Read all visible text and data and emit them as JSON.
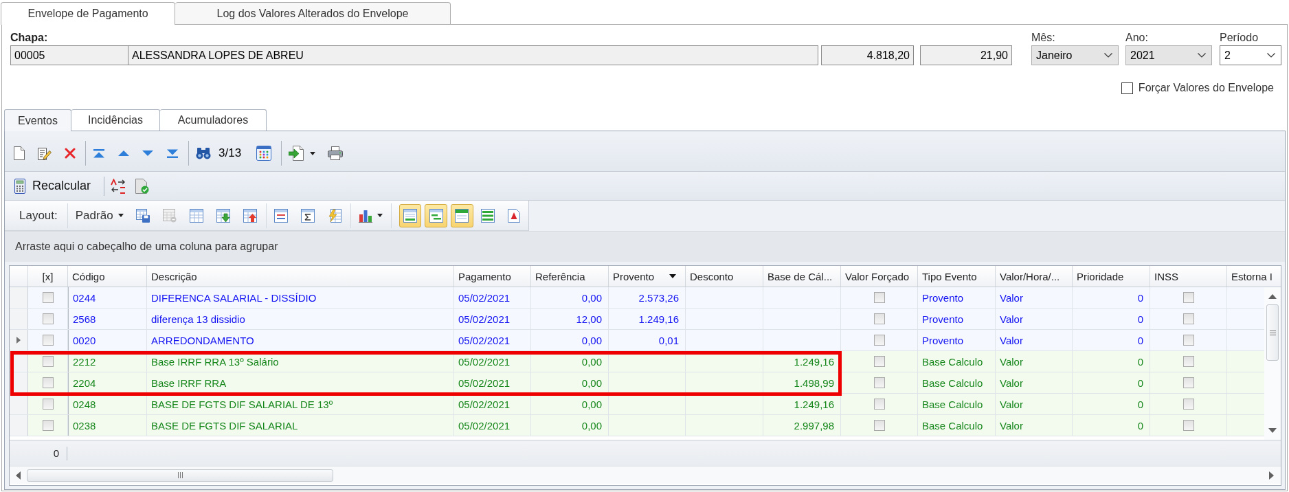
{
  "tabs": [
    {
      "label": "Envelope de Pagamento",
      "selected": true
    },
    {
      "label": "Log dos Valores Alterados do Envelope",
      "selected": false
    }
  ],
  "employee": {
    "label": "Chapa:",
    "code": "00005",
    "name": "ALESSANDRA LOPES DE ABREU",
    "value_1": "4.818,20",
    "value_2": "21,90"
  },
  "selectors": [
    {
      "label": "Mês:",
      "value": "Janeiro",
      "editable": false
    },
    {
      "label": "Ano:",
      "value": "2021",
      "editable": false
    },
    {
      "label": "Período",
      "value": "2",
      "editable": true
    }
  ],
  "force_values": {
    "label": "Forçar Valores do Envelope",
    "checked": false
  },
  "inner_tabs": [
    {
      "label": "Eventos",
      "selected": true
    },
    {
      "label": "Incidências",
      "selected": false
    },
    {
      "label": "Acumuladores",
      "selected": false
    }
  ],
  "navigator": {
    "position": "3/13"
  },
  "actions": {
    "recalculate": "Recalcular"
  },
  "layout_bar": {
    "label": "Layout:",
    "layout": "Padrão",
    "view_toggles": [
      {
        "on": true
      },
      {
        "on": true
      },
      {
        "on": true
      },
      {
        "on": false
      },
      {
        "on": false
      }
    ]
  },
  "group_panel": {
    "hint": "Arraste aqui o cabeçalho de uma coluna para agrupar"
  },
  "table": {
    "columns": [
      {
        "label": "[x]",
        "kind": "check",
        "filter_button": false
      },
      {
        "label": "Código",
        "kind": "text",
        "filter_button": false
      },
      {
        "label": "Descrição",
        "kind": "text",
        "filter_button": false
      },
      {
        "label": "Pagamento",
        "kind": "text",
        "filter_button": false
      },
      {
        "label": "Referência",
        "kind": "number",
        "filter_button": false
      },
      {
        "label": "Provento",
        "kind": "number",
        "filter_button": true
      },
      {
        "label": "Desconto",
        "kind": "number",
        "filter_button": false
      },
      {
        "label": "Base de Cál...",
        "kind": "number",
        "filter_button": false
      },
      {
        "label": "Valor Forçado",
        "kind": "check",
        "filter_button": false
      },
      {
        "label": "Tipo Evento",
        "kind": "text",
        "filter_button": false
      },
      {
        "label": "Valor/Hora/...",
        "kind": "text",
        "filter_button": false
      },
      {
        "label": "Prioridade",
        "kind": "number",
        "filter_button": false
      },
      {
        "label": "INSS",
        "kind": "check",
        "filter_button": false
      },
      {
        "label": "Estorna I",
        "kind": "check",
        "filter_button": false
      }
    ],
    "rows": [
      {
        "selected": false,
        "highlighted": false,
        "kind": "provento",
        "marked": false,
        "code": "0244",
        "description": "DIFERENCA SALARIAL - DISSÍDIO",
        "payment_date": "05/02/2021",
        "reference": "0,00",
        "earning": "2.573,26",
        "forced_value": false,
        "event_type": "Provento",
        "value_type": "Valor",
        "priority": "0",
        "inss": false
      },
      {
        "selected": false,
        "highlighted": false,
        "kind": "provento",
        "marked": false,
        "code": "2568",
        "description": "diferença 13 dissidio",
        "payment_date": "05/02/2021",
        "reference": "12,00",
        "earning": "1.249,16",
        "forced_value": false,
        "event_type": "Provento",
        "value_type": "Valor",
        "priority": "0",
        "inss": false
      },
      {
        "selected": true,
        "highlighted": false,
        "kind": "provento",
        "marked": false,
        "code": "0020",
        "description": "ARREDONDAMENTO",
        "payment_date": "05/02/2021",
        "reference": "0,00",
        "earning": "0,01",
        "forced_value": false,
        "event_type": "Provento",
        "value_type": "Valor",
        "priority": "0",
        "inss": false
      },
      {
        "selected": false,
        "highlighted": true,
        "kind": "base",
        "marked": false,
        "code": "2212",
        "description": "Base IRRF RRA 13º Salário",
        "payment_date": "05/02/2021",
        "reference": "0,00",
        "calculation_base": "1.249,16",
        "forced_value": false,
        "event_type": "Base Calculo",
        "value_type": "Valor",
        "priority": "0",
        "inss": false
      },
      {
        "selected": false,
        "highlighted": true,
        "kind": "base",
        "marked": false,
        "code": "2204",
        "description": "Base IRRF RRA",
        "payment_date": "05/02/2021",
        "reference": "0,00",
        "calculation_base": "1.498,99",
        "forced_value": false,
        "event_type": "Base Calculo",
        "value_type": "Valor",
        "priority": "0",
        "inss": false
      },
      {
        "selected": false,
        "highlighted": false,
        "kind": "base",
        "marked": false,
        "code": "0248",
        "description": "BASE DE FGTS DIF SALARIAL DE 13º",
        "payment_date": "05/02/2021",
        "reference": "0,00",
        "calculation_base": "1.249,16",
        "forced_value": false,
        "event_type": "Base Calculo",
        "value_type": "Valor",
        "priority": "0",
        "inss": false
      },
      {
        "selected": false,
        "highlighted": false,
        "kind": "base",
        "marked": false,
        "code": "0238",
        "description": "BASE DE FGTS DIF SALARIAL",
        "payment_date": "05/02/2021",
        "reference": "0,00",
        "calculation_base": "2.997,98",
        "forced_value": false,
        "event_type": "Base Calculo",
        "value_type": "Valor",
        "priority": "0",
        "inss": false
      }
    ],
    "summary": "0"
  }
}
